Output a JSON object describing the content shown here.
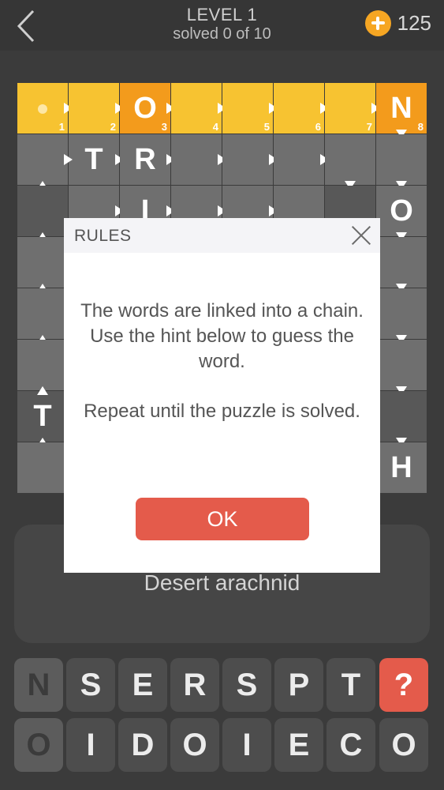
{
  "header": {
    "title": "LEVEL 1",
    "subtitle": "solved 0 of 10",
    "coins": "125",
    "back_icon": "chevron-left-icon",
    "coin_icon": "plus-coin-icon"
  },
  "board": {
    "top_row": [
      {
        "num": "1",
        "letter": ""
      },
      {
        "num": "2",
        "letter": ""
      },
      {
        "num": "3",
        "letter": "O"
      },
      {
        "num": "4",
        "letter": ""
      },
      {
        "num": "5",
        "letter": ""
      },
      {
        "num": "6",
        "letter": ""
      },
      {
        "num": "7",
        "letter": ""
      },
      {
        "num": "8",
        "letter": "N"
      }
    ],
    "revealed_letters": [
      "T",
      "R",
      "I",
      "O",
      "T",
      "H"
    ]
  },
  "hint": "Desert arachnid",
  "keyboard": {
    "row1": [
      "N",
      "S",
      "E",
      "R",
      "S",
      "P",
      "T",
      "?"
    ],
    "row2": [
      "O",
      "I",
      "D",
      "O",
      "I",
      "E",
      "C",
      "O"
    ]
  },
  "modal": {
    "title": "RULES",
    "paragraph1": "The words are linked into a chain. Use the hint below to guess the word.",
    "paragraph2": "Repeat until the puzzle is solved.",
    "ok_label": "OK"
  },
  "colors": {
    "accent_yellow": "#f7c331",
    "accent_orange": "#f39b1c",
    "button_red": "#e45b4b",
    "coin_orange": "#f6a623"
  }
}
